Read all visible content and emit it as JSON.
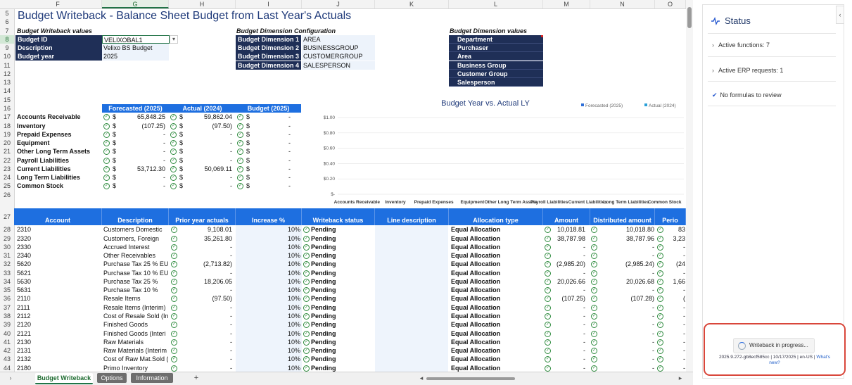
{
  "columns": [
    "F",
    "G",
    "H",
    "I",
    "J",
    "K",
    "L",
    "M",
    "N",
    "O"
  ],
  "selected_column": "G",
  "title": "Budget Writeback - Balance Sheet Budget from Last Year's Actuals",
  "writeback_values": {
    "heading": "Budget Writeback values",
    "rows": [
      [
        "Budget ID",
        "VELIXOBAL1"
      ],
      [
        "Description",
        "Velixo BS Budget"
      ],
      [
        "Budget year",
        "2025"
      ]
    ]
  },
  "dimension_config": {
    "heading": "Budget Dimension Configuration",
    "rows": [
      [
        "Budget Dimension 1",
        "AREA"
      ],
      [
        "Budget Dimension 2",
        "BUSINESSGROUP"
      ],
      [
        "Budget Dimension 3",
        "CUSTOMERGROUP"
      ],
      [
        "Budget Dimension 4",
        "SALESPERSON"
      ]
    ]
  },
  "dimension_values": {
    "heading": "Budget Dimension values",
    "items": [
      "Department",
      "Purchaser",
      "Area",
      "Business Group",
      "Customer Group",
      "Salesperson"
    ]
  },
  "summary": {
    "headers": [
      "Forecasted (2025)",
      "Actual (2024)",
      "Budget (2025)"
    ],
    "rows": [
      [
        "Accounts Receivable",
        "65,848.25",
        "59,862.04",
        "-"
      ],
      [
        "Inventory",
        "(107.25)",
        "(97.50)",
        "-"
      ],
      [
        "Prepaid Expenses",
        "-",
        "-",
        "-"
      ],
      [
        "Equipment",
        "-",
        "-",
        "-"
      ],
      [
        "Other Long Term Assets",
        "-",
        "-",
        "-"
      ],
      [
        "Payroll Liabilities",
        "-",
        "-",
        "-"
      ],
      [
        "Current Liabilities",
        "53,712.30",
        "50,069.11",
        "-"
      ],
      [
        "Long Term Liabilities",
        "-",
        "-",
        "-"
      ],
      [
        "Common Stock",
        "-",
        "-",
        "-"
      ]
    ]
  },
  "chart_data": {
    "type": "bar",
    "title": "Budget Year vs. Actual LY",
    "categories": [
      "Accounts Receivable",
      "Inventory",
      "Prepaid Expenses",
      "Equipment",
      "Other Long Term Assets",
      "Payroll Liabilities",
      "Current Liabilities",
      "Long Term Liabilities",
      "Common Stock"
    ],
    "series": [
      {
        "name": "Forecasted (2025)",
        "values": [
          0,
          0,
          0,
          0,
          0,
          0,
          0,
          0,
          0
        ],
        "color": "#2e6fd8"
      },
      {
        "name": "Actual (2024)",
        "values": [
          0,
          0,
          0,
          0,
          0,
          0,
          0,
          0,
          0
        ],
        "color": "#2aa0d8"
      }
    ],
    "yticks": [
      "$1.00",
      "$0.80",
      "$0.60",
      "$0.40",
      "$0.20",
      "$-"
    ],
    "ylim": [
      0,
      1
    ],
    "legend": "top-right"
  },
  "table": {
    "headers": [
      "Account",
      "Description",
      "Prior year actuals",
      "Increase %",
      "Writeback status",
      "Line description",
      "Allocation type",
      "Amount",
      "Distributed amount",
      "Perio"
    ],
    "rows": [
      [
        "2310",
        "Customers Domestic",
        "9,108.01",
        "10%",
        "Pending",
        "Equal Allocation",
        "10,018.81",
        "10,018.80",
        "83"
      ],
      [
        "2320",
        "Customers, Foreign",
        "35,261.80",
        "10%",
        "Pending",
        "Equal Allocation",
        "38,787.98",
        "38,787.96",
        "3,23"
      ],
      [
        "2330",
        "Accrued Interest",
        "-",
        "10%",
        "Pending",
        "Equal Allocation",
        "-",
        "-",
        "-"
      ],
      [
        "2340",
        "Other Receivables",
        "-",
        "10%",
        "Pending",
        "Equal Allocation",
        "-",
        "-",
        "-"
      ],
      [
        "5620",
        "Purchase Tax 25 % EU",
        "(2,713.82)",
        "10%",
        "Pending",
        "Equal Allocation",
        "(2,985.20)",
        "(2,985.24)",
        "(24"
      ],
      [
        "5621",
        "Purchase Tax 10 % EU",
        "-",
        "10%",
        "Pending",
        "Equal Allocation",
        "-",
        "-",
        "-"
      ],
      [
        "5630",
        "Purchase Tax 25 %",
        "18,206.05",
        "10%",
        "Pending",
        "Equal Allocation",
        "20,026.66",
        "20,026.68",
        "1,66"
      ],
      [
        "5631",
        "Purchase Tax 10 %",
        "-",
        "10%",
        "Pending",
        "Equal Allocation",
        "-",
        "-",
        "-"
      ],
      [
        "2110",
        "Resale Items",
        "(97.50)",
        "10%",
        "Pending",
        "Equal Allocation",
        "(107.25)",
        "(107.28)",
        "("
      ],
      [
        "2111",
        "Resale Items (Interim)",
        "-",
        "10%",
        "Pending",
        "Equal Allocation",
        "-",
        "-",
        "-"
      ],
      [
        "2112",
        "Cost of Resale Sold (In",
        "-",
        "10%",
        "Pending",
        "Equal Allocation",
        "-",
        "-",
        "-"
      ],
      [
        "2120",
        "Finished Goods",
        "-",
        "10%",
        "Pending",
        "Equal Allocation",
        "-",
        "-",
        "-"
      ],
      [
        "2121",
        "Finished Goods (Interi",
        "-",
        "10%",
        "Pending",
        "Equal Allocation",
        "-",
        "-",
        "-"
      ],
      [
        "2130",
        "Raw Materials",
        "-",
        "10%",
        "Pending",
        "Equal Allocation",
        "-",
        "-",
        "-"
      ],
      [
        "2131",
        "Raw Materials (Interim",
        "-",
        "10%",
        "Pending",
        "Equal Allocation",
        "-",
        "-",
        "-"
      ],
      [
        "2132",
        "Cost of Raw Mat.Sold (",
        "-",
        "10%",
        "Pending",
        "Equal Allocation",
        "-",
        "-",
        "-"
      ],
      [
        "2180",
        "Primo Inventory",
        "-",
        "10%",
        "Pending",
        "Equal Allocation",
        "-",
        "-",
        "-"
      ]
    ]
  },
  "sheet_tabs": [
    "Budget Writeback",
    "Options",
    "Information"
  ],
  "add_sheet": "+",
  "status_pane": {
    "title": "Status",
    "items": [
      "Active functions: 7",
      "Active ERP requests: 1",
      "No formulas to review"
    ],
    "progress": "Writeback in progress...",
    "footer": "2025.9.272-gb8ecf585cc | 10/17/2025 | en-US |",
    "whats_new": "What's new?"
  }
}
